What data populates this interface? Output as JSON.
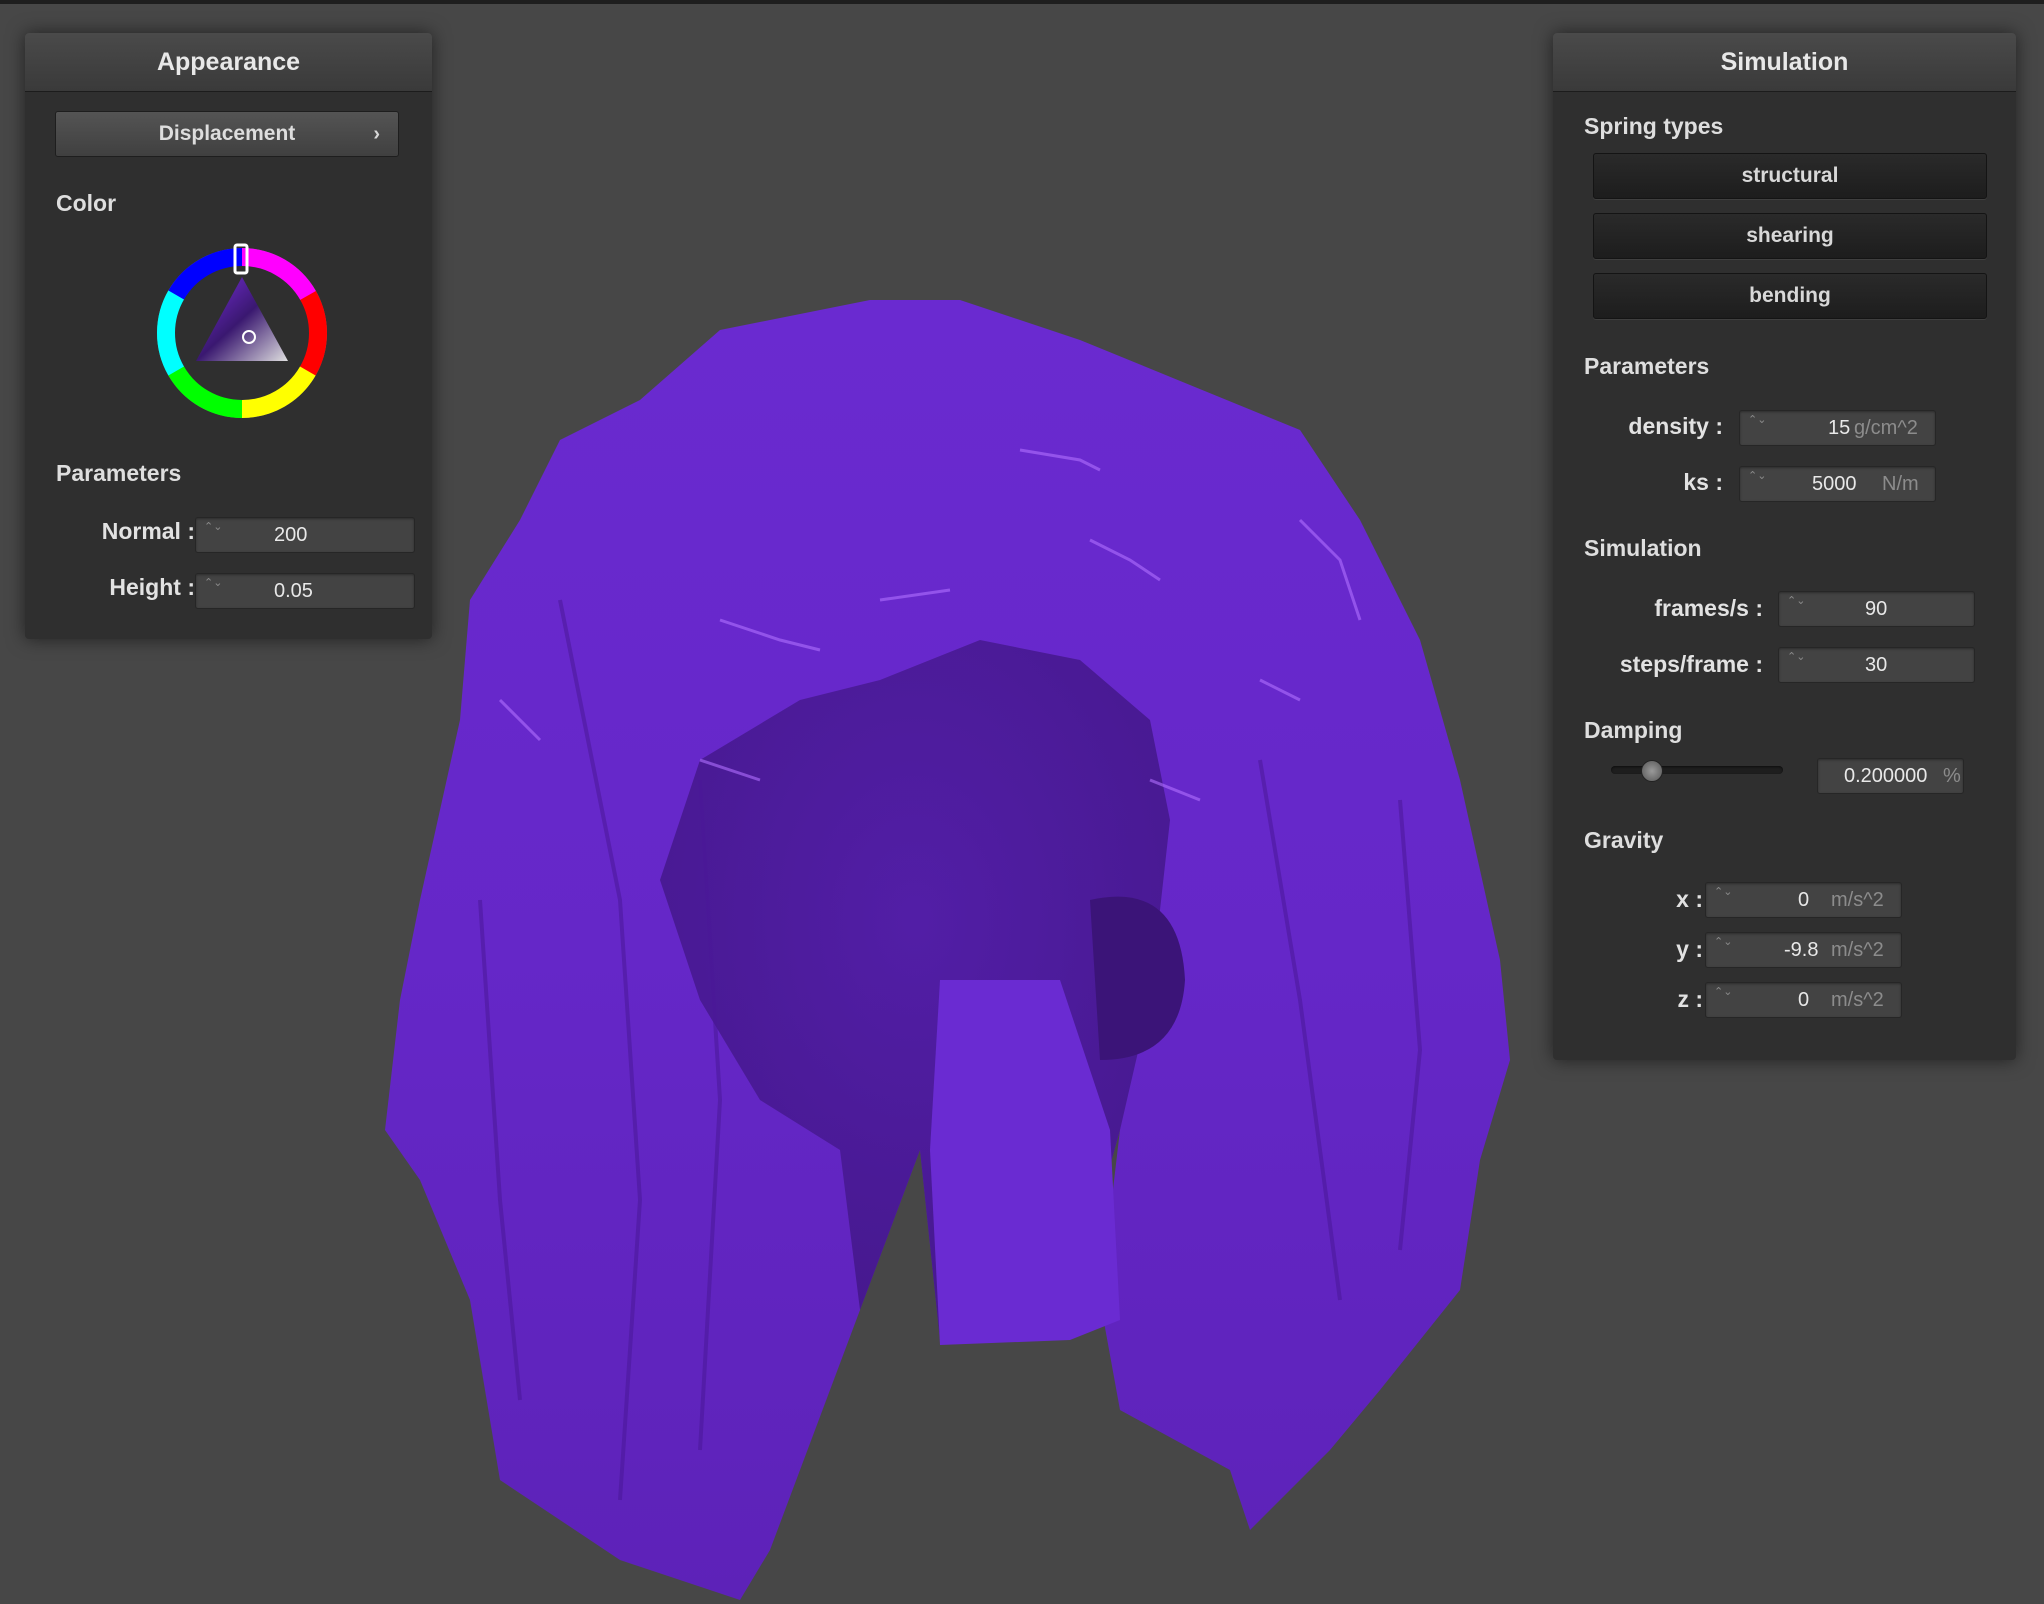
{
  "appearance": {
    "title": "Appearance",
    "displacement_button": "Displacement",
    "chevron_glyph": "›",
    "color_label": "Color",
    "parameters_label": "Parameters",
    "normal_label": "Normal :",
    "normal_value": "200",
    "height_label": "Height :",
    "height_value": "0.05",
    "selected_color": "#7a2fe0"
  },
  "simulation": {
    "title": "Simulation",
    "spring_types_label": "Spring types",
    "spring_types": [
      "structural",
      "shearing",
      "bending"
    ],
    "parameters_label": "Parameters",
    "density_label": "density :",
    "density_value": "15",
    "density_unit": "g/cm^2",
    "ks_label": "ks :",
    "ks_value": "5000",
    "ks_unit": "N/m",
    "simulation_label": "Simulation",
    "fps_label": "frames/s :",
    "fps_value": "90",
    "steps_label": "steps/frame :",
    "steps_value": "30",
    "damping_label": "Damping",
    "damping_value": "0.200000",
    "damping_unit": "%",
    "damping_slider_fraction": 0.2,
    "gravity_label": "Gravity",
    "gx_label": "x :",
    "gx_value": "0",
    "gy_label": "y :",
    "gy_value": "-9.8",
    "gz_label": "z :",
    "gz_value": "0",
    "gravity_unit": "m/s^2"
  },
  "spin_glyph": "⌃⌄"
}
